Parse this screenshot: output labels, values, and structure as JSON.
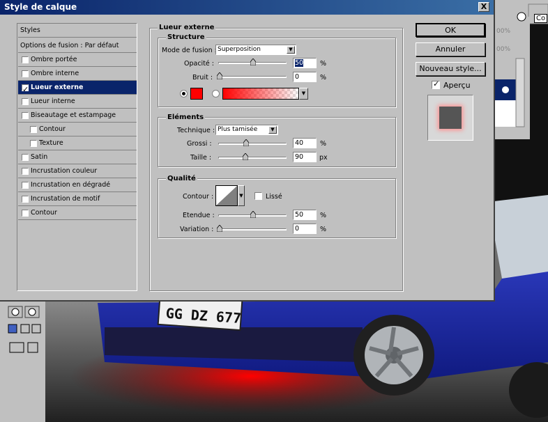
{
  "dialog": {
    "title": "Style de calque",
    "close_label": "X"
  },
  "list_items": [
    {
      "label": "Styles",
      "checked": false,
      "type": "header"
    },
    {
      "label": "Options de fusion : Par défaut",
      "checked": false,
      "type": "header"
    },
    {
      "label": "Ombre portée",
      "checked": false,
      "type": "item"
    },
    {
      "label": "Ombre interne",
      "checked": false,
      "type": "item"
    },
    {
      "label": "Lueur externe",
      "checked": true,
      "type": "selected"
    },
    {
      "label": "Lueur interne",
      "checked": false,
      "type": "item"
    },
    {
      "label": "Biseautage et estampage",
      "checked": false,
      "type": "item"
    },
    {
      "label": "Contour",
      "checked": false,
      "type": "indent"
    },
    {
      "label": "Texture",
      "checked": false,
      "type": "indent"
    },
    {
      "label": "Satin",
      "checked": false,
      "type": "item"
    },
    {
      "label": "Incrustation couleur",
      "checked": false,
      "type": "item"
    },
    {
      "label": "Incrustation en dégradé",
      "checked": false,
      "type": "item"
    },
    {
      "label": "Incrustation de motif",
      "checked": false,
      "type": "item"
    },
    {
      "label": "Contour",
      "checked": false,
      "type": "item"
    }
  ],
  "panel": {
    "title": "Lueur externe",
    "structure": {
      "title": "Structure",
      "blend_mode_label": "Mode de fusion :",
      "blend_mode_value": "Superposition",
      "opacity_label": "Opacité :",
      "opacity_value": "50",
      "opacity_unit": "%",
      "noise_label": "Bruit :",
      "noise_value": "0",
      "noise_unit": "%",
      "color": "#ff0000"
    },
    "elements": {
      "title": "Eléments",
      "technique_label": "Technique :",
      "technique_value": "Plus tamisée",
      "spread_label": "Grossi :",
      "spread_value": "40",
      "spread_unit": "%",
      "size_label": "Taille :",
      "size_value": "90",
      "size_unit": "px"
    },
    "quality": {
      "title": "Qualité",
      "contour_label": "Contour :",
      "smooth_label": "Lissé",
      "range_label": "Etendue :",
      "range_value": "50",
      "range_unit": "%",
      "jitter_label": "Variation :",
      "jitter_value": "0",
      "jitter_unit": "%"
    }
  },
  "buttons": {
    "ok": "OK",
    "cancel": "Annuler",
    "new_style": "Nouveau style...",
    "preview_label": "Aperçu"
  },
  "background": {
    "license_plate": "GG DZ 677",
    "zoom_1": "00%",
    "zoom_2": "00%",
    "tab_label": "Co"
  }
}
